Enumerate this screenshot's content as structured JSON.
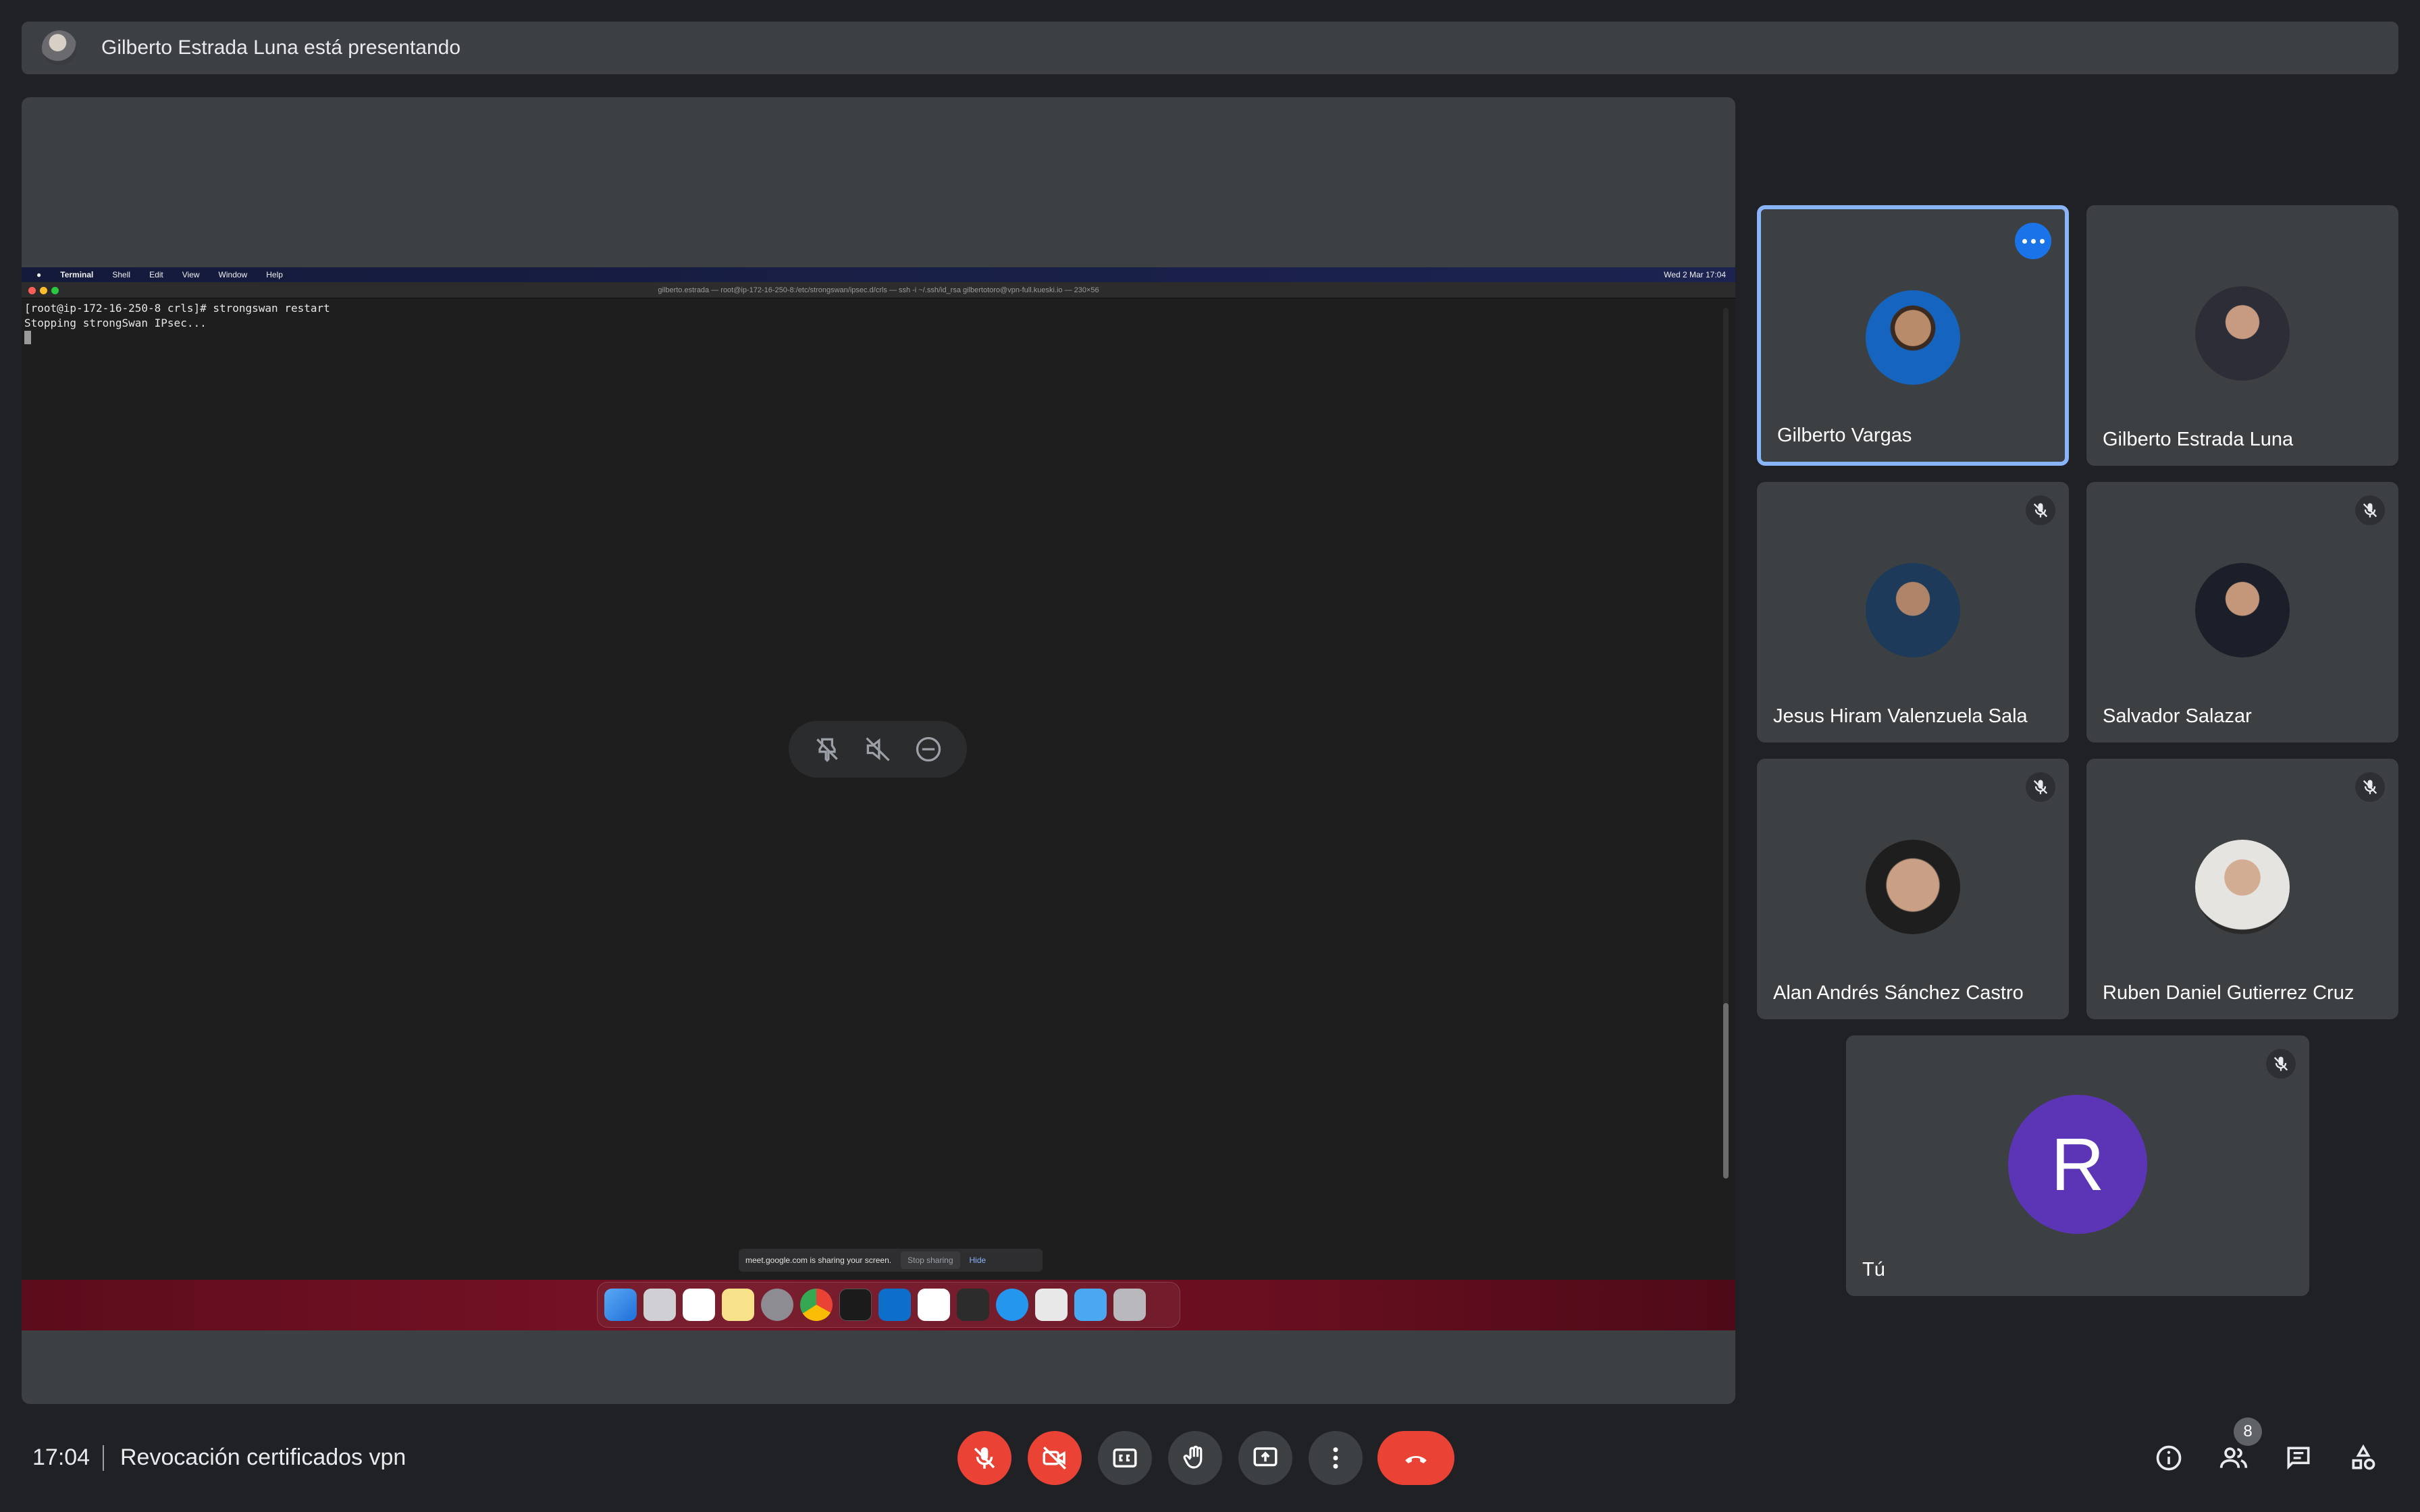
{
  "banner": {
    "presenting_text": "Gilberto Estrada Luna está presentando"
  },
  "shared_screen": {
    "menubar": {
      "app": "Terminal",
      "items": [
        "Shell",
        "Edit",
        "View",
        "Window",
        "Help"
      ],
      "status_right": "Wed 2 Mar  17:04"
    },
    "window_title": "gilberto.estrada — root@ip-172-16-250-8:/etc/strongswan/ipsec.d/crls — ssh -i ~/.ssh/id_rsa gilbertotoro@vpn-full.kueski.io — 230×56",
    "terminal_lines": [
      "[root@ip-172-16-250-8 crls]# strongswan restart",
      "Stopping strongSwan IPsec..."
    ],
    "share_notice": {
      "text": "meet.google.com is sharing your screen.",
      "stop": "Stop sharing",
      "hide": "Hide"
    }
  },
  "participants": [
    {
      "name": "Gilberto Vargas",
      "active": true
    },
    {
      "name": "Gilberto Estrada Luna"
    },
    {
      "name": "Jesus Hiram Valenzuela Sala",
      "muted": true
    },
    {
      "name": "Salvador Salazar",
      "muted": true
    },
    {
      "name": "Alan Andrés Sánchez Castro",
      "muted": true
    },
    {
      "name": "Ruben Daniel Gutierrez Cruz",
      "muted": true
    }
  ],
  "self_tile": {
    "name": "Tú",
    "initial": "R",
    "avatar_color": "#5b35b5",
    "muted": true
  },
  "footer": {
    "time": "17:04",
    "meeting_title": "Revocación certificados vpn",
    "people_count": "8"
  },
  "colors": {
    "background": "#202124",
    "tile": "#3c4043",
    "danger": "#ea4335",
    "accent": "#8ab4f8"
  }
}
